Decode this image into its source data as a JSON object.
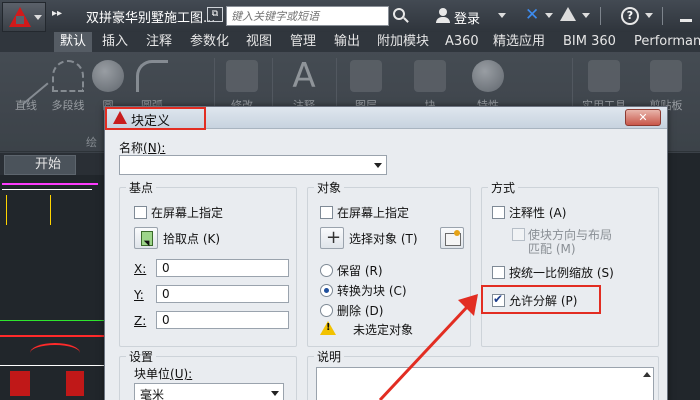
{
  "titlebar": {
    "doc_title": "双拼豪华别墅施工图...",
    "search_placeholder": "键入关键字或短语",
    "login_label": "登录"
  },
  "ribbon": {
    "tabs": [
      "默认",
      "插入",
      "注释",
      "参数化",
      "视图",
      "管理",
      "输出",
      "附加模块",
      "A360",
      "精选应用",
      "BIM 360",
      "Performance"
    ],
    "active_tab": "默认",
    "tools": [
      {
        "label": "直线",
        "icon": "line-icon"
      },
      {
        "label": "多段线",
        "icon": "polyline-icon"
      },
      {
        "label": "圆",
        "icon": "circle-icon"
      },
      {
        "label": "圆弧",
        "icon": "arc-icon"
      },
      {
        "label": "修改",
        "icon": "move-icon"
      },
      {
        "label": "注释",
        "icon": "text-icon"
      },
      {
        "label": "图层",
        "icon": "layers-icon"
      },
      {
        "label": "块",
        "icon": "block-icon"
      },
      {
        "label": "特性",
        "icon": "properties-icon"
      },
      {
        "label": "实用工具",
        "icon": "calculator-icon"
      },
      {
        "label": "剪贴板",
        "icon": "clipboard-icon"
      }
    ],
    "panel_title": "绘"
  },
  "doc_tab": {
    "label": "开始"
  },
  "dialog": {
    "title": "块定义",
    "name_label": "名称",
    "name_key": "(N):",
    "name_value": "",
    "base_point": {
      "title": "基点",
      "specify_on_screen": "在屏幕上指定",
      "specify_checked": false,
      "pick_point": "拾取点",
      "pick_point_key": "(K)",
      "x_label": "X:",
      "y_label": "Y:",
      "z_label": "Z:",
      "x_value": "0",
      "y_value": "0",
      "z_value": "0"
    },
    "objects": {
      "title": "对象",
      "specify_on_screen": "在屏幕上指定",
      "specify_checked": false,
      "select_objects": "选择对象",
      "select_objects_key": "(T)",
      "retain": "保留",
      "retain_key": "(R)",
      "convert": "转换为块",
      "convert_key": "(C)",
      "delete": "删除",
      "delete_key": "(D)",
      "selected_option": "convert",
      "warning": "未选定对象"
    },
    "behavior": {
      "title": "方式",
      "annotative": "注释性",
      "annotative_key": "(A)",
      "annotative_checked": false,
      "match_orientation_line1": "使块方向与布局",
      "match_orientation_line2": "匹配",
      "match_orientation_key": "(M)",
      "match_orientation_checked": false,
      "scale_uniformly": "按统一比例缩放",
      "scale_uniformly_key": "(S)",
      "scale_uniformly_checked": false,
      "allow_exploding": "允许分解",
      "allow_exploding_key": "(P)",
      "allow_exploding_checked": true
    },
    "settings": {
      "title": "设置",
      "block_unit_label": "块单位",
      "block_unit_key": "(U):",
      "block_unit_value": "毫米"
    },
    "description": {
      "title": "说明",
      "value": ""
    }
  },
  "colors": {
    "highlight": "#e22d22",
    "accent_blue": "#1f4f9d",
    "cad_red": "#d21a1a"
  }
}
